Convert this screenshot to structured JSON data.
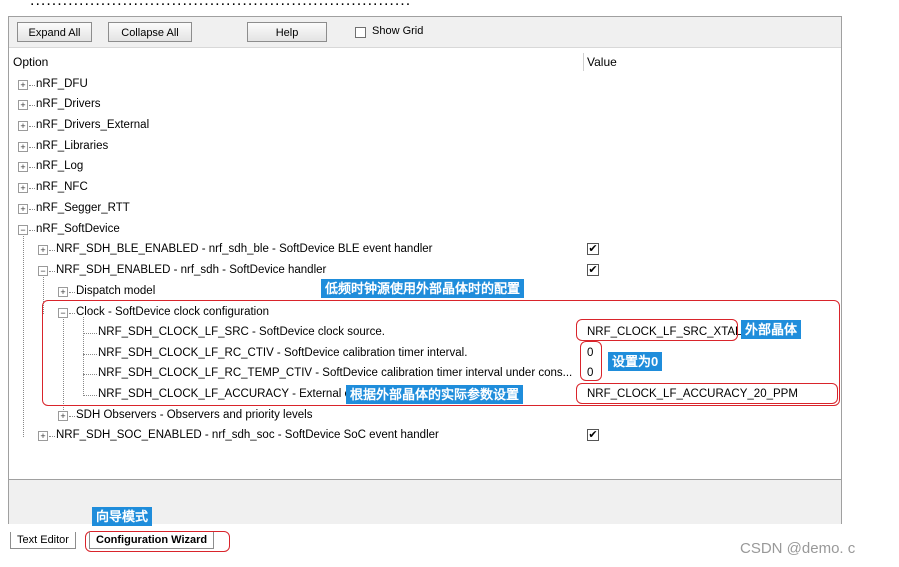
{
  "toolbar": {
    "expand_all": "Expand All",
    "collapse_all": "Collapse All",
    "help": "Help",
    "show_grid": "Show Grid"
  },
  "columns": {
    "option": "Option",
    "value": "Value"
  },
  "tree": {
    "nrf_dfu": "nRF_DFU",
    "nrf_drivers": "nRF_Drivers",
    "nrf_drivers_external": "nRF_Drivers_External",
    "nrf_libraries": "nRF_Libraries",
    "nrf_log": "nRF_Log",
    "nrf_nfc": "nRF_NFC",
    "nrf_segger_rtt": "nRF_Segger_RTT",
    "nrf_softdevice": "nRF_SoftDevice",
    "ble_enabled": "NRF_SDH_BLE_ENABLED - nrf_sdh_ble - SoftDevice BLE event handler",
    "sdh_enabled": "NRF_SDH_ENABLED - nrf_sdh - SoftDevice handler",
    "dispatch_model": "Dispatch model",
    "clock": "Clock - SoftDevice clock configuration",
    "lf_src": "NRF_SDH_CLOCK_LF_SRC  - SoftDevice clock source.",
    "lf_rc_ctiv": "NRF_SDH_CLOCK_LF_RC_CTIV - SoftDevice calibration timer interval.",
    "lf_rc_temp_ctiv": "NRF_SDH_CLOCK_LF_RC_TEMP_CTIV - SoftDevice calibration timer interval under cons...",
    "lf_accuracy": "NRF_SDH_CLOCK_LF_ACCURACY  - External cl",
    "sdh_observers": "SDH Observers - Observers and priority levels",
    "soc_enabled": "NRF_SDH_SOC_ENABLED - nrf_sdh_soc - SoftDevice SoC event handler"
  },
  "values": {
    "ble_enabled_check": "✔",
    "sdh_enabled_check": "✔",
    "soc_enabled_check": "✔",
    "lf_src": "NRF_CLOCK_LF_SRC_XTAL",
    "lf_rc_ctiv": "0",
    "lf_rc_temp_ctiv": "0",
    "lf_accuracy": "NRF_CLOCK_LF_ACCURACY_20_PPM"
  },
  "annotations": {
    "clock_note": "低频时钟源使用外部晶体时的配置",
    "xtal_note": "外部晶体",
    "zero_note": "设置为0",
    "accuracy_note": "根据外部晶体的实际参数设置",
    "wizard_note": "向导模式"
  },
  "tabs": {
    "text_editor": "Text Editor",
    "config_wizard": "Configuration Wizard"
  },
  "watermark": "CSDN @demo. c",
  "colors": {
    "accent": "#1f8ddb",
    "highlight": "#d9242b"
  }
}
